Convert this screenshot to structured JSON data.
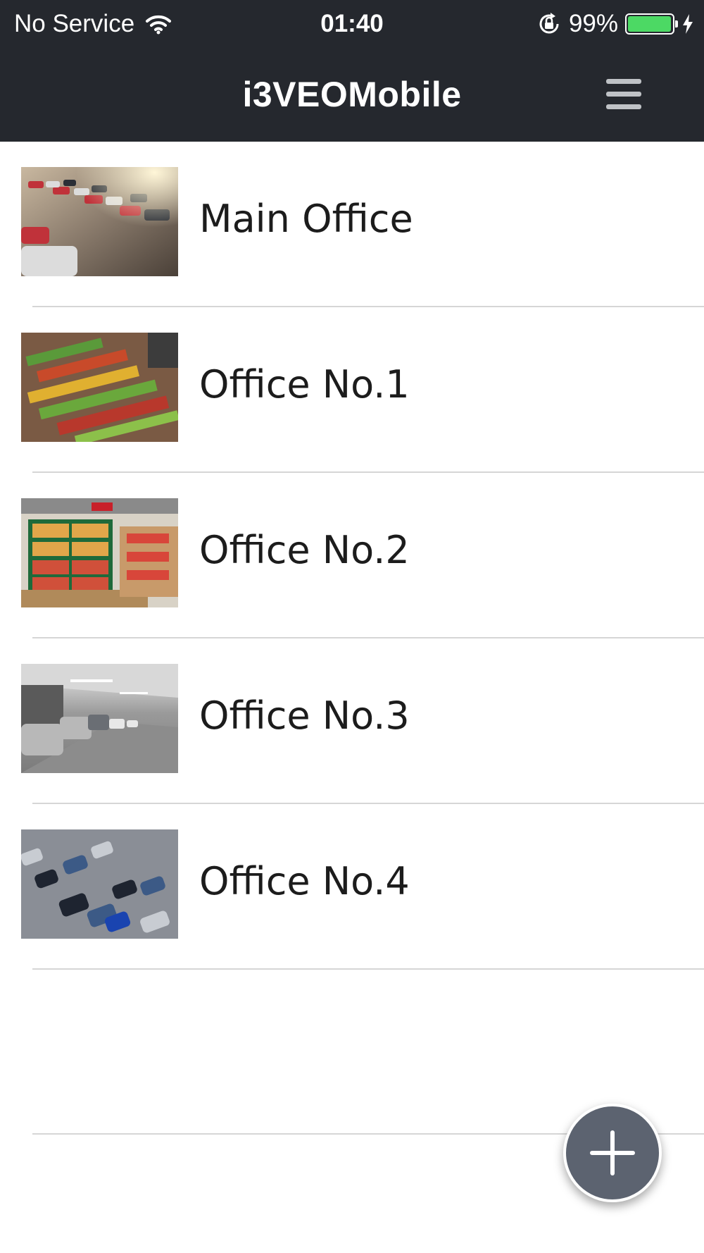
{
  "status_bar": {
    "carrier": "No Service",
    "time": "01:40",
    "battery_percent": "99%",
    "battery_level": 0.99,
    "icons": [
      "wifi-icon",
      "rotation-lock-icon",
      "battery-icon",
      "charging-bolt-icon"
    ]
  },
  "header": {
    "title": "i3VEOMobile",
    "menu_icon": "hamburger-menu-icon"
  },
  "sites": [
    {
      "label": "Main Office",
      "thumbnail": "parking-lot-sunset-photo"
    },
    {
      "label": "Office No.1",
      "thumbnail": "produce-market-aerial-photo"
    },
    {
      "label": "Office No.2",
      "thumbnail": "supermarket-produce-photo"
    },
    {
      "label": "Office No.3",
      "thumbnail": "underground-garage-photo"
    },
    {
      "label": "Office No.4",
      "thumbnail": "parking-lot-aerial-photo"
    }
  ],
  "fab": {
    "icon": "plus-icon"
  },
  "colors": {
    "header_bg": "#25282e",
    "battery_green": "#4cd964",
    "fab_bg": "#5c6370",
    "divider": "#d6d6d6"
  }
}
